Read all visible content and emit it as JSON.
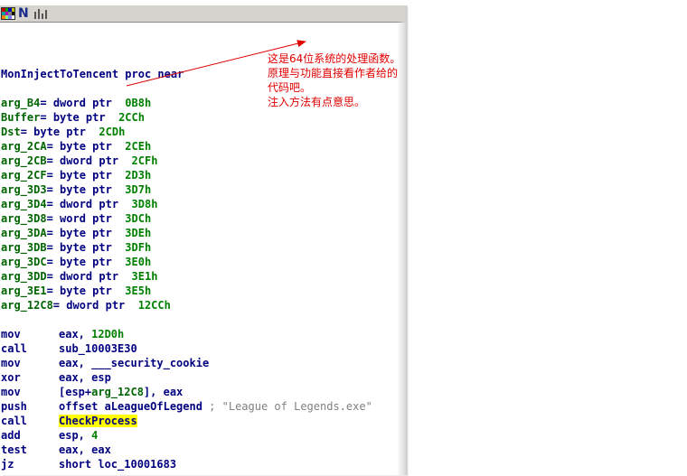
{
  "titlebar": {
    "icons": [
      "color-grid-icon",
      "n-letter-icon",
      "graph-bars-icon"
    ],
    "n_glyph": "N"
  },
  "code": {
    "proc_line": {
      "name": "MonInjectToTencent",
      "rest": " proc near"
    },
    "args": [
      {
        "name": "arg_B4",
        "type": "dword ptr",
        "offset": "0B8h"
      },
      {
        "name": "Buffer",
        "type": "byte ptr",
        "offset": "2CCh"
      },
      {
        "name": "Dst",
        "type": "byte ptr",
        "offset": "2CDh"
      },
      {
        "name": "arg_2CA",
        "type": "byte ptr",
        "offset": "2CEh"
      },
      {
        "name": "arg_2CB",
        "type": "dword ptr",
        "offset": "2CFh"
      },
      {
        "name": "arg_2CF",
        "type": "byte ptr",
        "offset": "2D3h"
      },
      {
        "name": "arg_3D3",
        "type": "byte ptr",
        "offset": "3D7h"
      },
      {
        "name": "arg_3D4",
        "type": "dword ptr",
        "offset": "3D8h"
      },
      {
        "name": "arg_3D8",
        "type": "word ptr",
        "offset": "3DCh"
      },
      {
        "name": "arg_3DA",
        "type": "byte ptr",
        "offset": "3DEh"
      },
      {
        "name": "arg_3DB",
        "type": "byte ptr",
        "offset": "3DFh"
      },
      {
        "name": "arg_3DC",
        "type": "byte ptr",
        "offset": "3E0h"
      },
      {
        "name": "arg_3DD",
        "type": "dword ptr",
        "offset": "3E1h"
      },
      {
        "name": "arg_3E1",
        "type": "byte ptr",
        "offset": "3E5h"
      },
      {
        "name": "arg_12C8",
        "type": "dword ptr",
        "offset": "12CCh"
      }
    ],
    "instructions": [
      {
        "mnemonic": "mov",
        "operands": "eax, ",
        "value": "12D0h"
      },
      {
        "mnemonic": "call",
        "operands": "sub_10003E30"
      },
      {
        "mnemonic": "mov",
        "operands": "eax, ___security_cookie"
      },
      {
        "mnemonic": "xor",
        "operands": "eax, esp"
      },
      {
        "mnemonic": "mov",
        "operands_a": "[esp+",
        "operands_var": "arg_12C8",
        "operands_b": "], eax"
      },
      {
        "mnemonic": "push",
        "operands": "offset aLeagueOfLegend ",
        "comment": "; \"League of Legends.exe\""
      },
      {
        "mnemonic": "call",
        "operands": "CheckProcess"
      },
      {
        "mnemonic": "add",
        "operands": "esp, ",
        "value": "4"
      },
      {
        "mnemonic": "test",
        "operands": "eax, eax"
      },
      {
        "mnemonic": "jz",
        "operands": "short loc_10001683"
      }
    ]
  },
  "annotation": {
    "lines": [
      "这是64位系统的处理函数。",
      "原理与功能直接看作者给的",
      "代码吧。",
      "注入方法有点意思。"
    ],
    "color": "#e00000"
  }
}
